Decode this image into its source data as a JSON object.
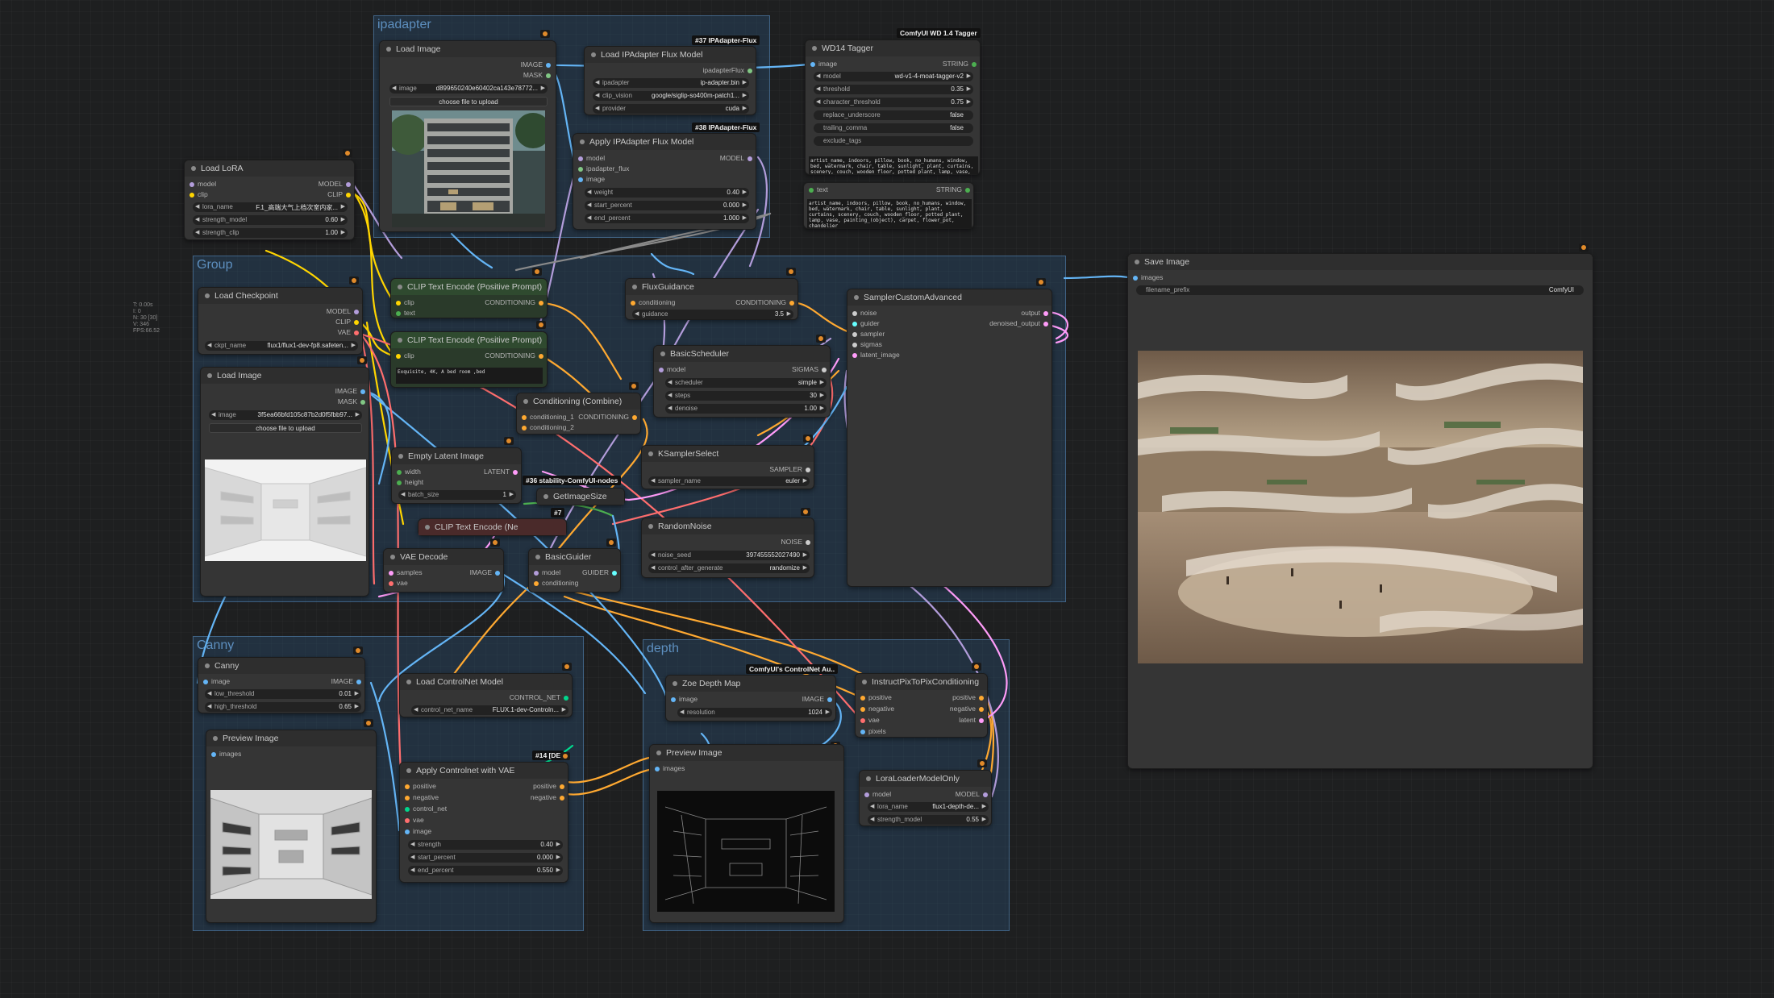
{
  "stats": {
    "l1": "T: 0.00s",
    "l2": "I: 0",
    "l3": "N: 30 [30]",
    "l4": "V: 346",
    "l5": "FPS:66.52"
  },
  "groups": {
    "ipadapter": "ipadapter",
    "group": "Group",
    "canny": "Canny",
    "depth": "depth"
  },
  "badges": {
    "b37": "#37 IPAdapter-Flux",
    "b38": "#38 IPAdapter-Flux",
    "wd14": "ComfyUI WD 1.4 Tagger",
    "b36": "#36 stability-ComfyUI-nodes",
    "b7": "#7",
    "ctrlnet": "ComfyUI's ControlNet Au..",
    "b14": "#14 [DE"
  },
  "load_image_top": {
    "title": "Load Image",
    "out_image": "IMAGE",
    "out_mask": "MASK",
    "w_image_label": "image",
    "w_image_value": "d899650240e60402ca143e78772...",
    "btn": "choose file to upload"
  },
  "ipa_model": {
    "title": "Load IPAdapter Flux Model",
    "out": "ipadapterFlux",
    "w1l": "ipadapter",
    "w1v": "ip-adapter.bin",
    "w2l": "clip_vision",
    "w2v": "google/siglip-so400m-patch1...",
    "w3l": "provider",
    "w3v": "cuda"
  },
  "apply_ipa": {
    "title": "Apply IPAdapter Flux Model",
    "in1": "model",
    "in2": "ipadapter_flux",
    "in3": "image",
    "out": "MODEL",
    "w1l": "weight",
    "w1v": "0.40",
    "w2l": "start_percent",
    "w2v": "0.000",
    "w3l": "end_percent",
    "w3v": "1.000"
  },
  "wd14": {
    "title": "WD14 Tagger",
    "in": "image",
    "out": "STRING",
    "w1l": "model",
    "w1v": "wd-v1-4-moat-tagger-v2",
    "w2l": "threshold",
    "w2v": "0.35",
    "w3l": "character_threshold",
    "w3v": "0.75",
    "w4l": "replace_underscore",
    "w4v": "false",
    "w5l": "trailing_comma",
    "w5v": "false",
    "w6l": "exclude_tags",
    "tags": "artist_name, indoors, pillow, book, no_humans, window, bed, watermark, chair, table, sunlight, plant, curtains, scenery, couch, wooden_floor, potted_plant, lamp, vase, painting_(object), carpet, flower_pot, chandelier"
  },
  "show_text": {
    "in": "text",
    "out": "STRING",
    "text": "artist_name, indoors, pillow, book, no_humans, window, bed, watermark, chair, table, sunlight, plant, curtains, scenery, couch, wooden_floor, potted_plant, lamp, vase, painting_(object), carpet, flower_pot, chandelier"
  },
  "load_lora": {
    "title": "Load LoRA",
    "in1": "model",
    "in2": "clip",
    "out1": "MODEL",
    "out2": "CLIP",
    "w1l": "lora_name",
    "w1v": "F.1_高端大气上档次室内家...",
    "w2l": "strength_model",
    "w2v": "0.60",
    "w3l": "strength_clip",
    "w3v": "1.00"
  },
  "load_ckpt": {
    "title": "Load Checkpoint",
    "o1": "MODEL",
    "o2": "CLIP",
    "o3": "VAE",
    "wl": "ckpt_name",
    "wv": "flux1/flux1-dev-fp8.safeten..."
  },
  "load_image_mid": {
    "title": "Load Image",
    "o1": "IMAGE",
    "o2": "MASK",
    "wl": "image",
    "wv": "3f5ea66bfd105c87b2d0f5fbb97...",
    "btn": "choose file to upload"
  },
  "clip_pos1": {
    "title": "CLIP Text Encode (Positive Prompt)",
    "in1": "clip",
    "in2": "text",
    "out": "CONDITIONING"
  },
  "clip_pos2": {
    "title": "CLIP Text Encode (Positive Prompt)",
    "in1": "clip",
    "out": "CONDITIONING",
    "text": "Exquisite, 4K, A bed room ,bed"
  },
  "flux_guid": {
    "title": "FluxGuidance",
    "in": "conditioning",
    "out": "CONDITIONING",
    "wl": "guidance",
    "wv": "3.5"
  },
  "sched": {
    "title": "BasicScheduler",
    "in": "model",
    "out": "SIGMAS",
    "w1l": "scheduler",
    "w1v": "simple",
    "w2l": "steps",
    "w2v": "30",
    "w3l": "denoise",
    "w3v": "1.00"
  },
  "cond_comb": {
    "title": "Conditioning (Combine)",
    "in1": "conditioning_1",
    "in2": "conditioning_2",
    "out": "CONDITIONING"
  },
  "empty_latent": {
    "title": "Empty Latent Image",
    "in1": "width",
    "in2": "height",
    "out": "LATENT",
    "wl": "batch_size",
    "wv": "1"
  },
  "get_size": {
    "title": "GetImageSize"
  },
  "clip_neg": {
    "title": "CLIP Text Encode (Ne"
  },
  "vae_decode": {
    "title": "VAE Decode",
    "in1": "samples",
    "in2": "vae",
    "out": "IMAGE"
  },
  "basic_guider": {
    "title": "BasicGuider",
    "in1": "model",
    "in2": "conditioning",
    "out": "GUIDER"
  },
  "ksampler_sel": {
    "title": "KSamplerSelect",
    "out": "SAMPLER",
    "wl": "sampler_name",
    "wv": "euler"
  },
  "random_noise": {
    "title": "RandomNoise",
    "out": "NOISE",
    "w1l": "noise_seed",
    "w1v": "397455552027490",
    "w2l": "control_after_generate",
    "w2v": "randomize"
  },
  "sampler_adv": {
    "title": "SamplerCustomAdvanced",
    "in1": "noise",
    "in2": "guider",
    "in3": "sampler",
    "in4": "sigmas",
    "in5": "latent_image",
    "out1": "output",
    "out2": "denoised_output"
  },
  "save_image": {
    "title": "Save Image",
    "in": "images",
    "wl": "filename_prefix",
    "wv": "ComfyUI"
  },
  "canny": {
    "title": "Canny",
    "in": "image",
    "out": "IMAGE",
    "w1l": "low_threshold",
    "w1v": "0.01",
    "w2l": "high_threshold",
    "w2v": "0.65"
  },
  "preview1": {
    "title": "Preview Image",
    "in": "images"
  },
  "load_cn": {
    "title": "Load ControlNet Model",
    "out": "CONTROL_NET",
    "wl": "control_net_name",
    "wv": "FLUX.1-dev-Controln..."
  },
  "apply_cn": {
    "title": "Apply Controlnet with VAE",
    "in1": "positive",
    "in2": "negative",
    "in3": "control_net",
    "in4": "vae",
    "in5": "image",
    "out1": "positive",
    "out2": "negative",
    "w1l": "strength",
    "w1v": "0.40",
    "w2l": "start_percent",
    "w2v": "0.000",
    "w3l": "end_percent",
    "w3v": "0.550"
  },
  "zoe": {
    "title": "Zoe Depth Map",
    "in": "image",
    "out": "IMAGE",
    "wl": "resolution",
    "wv": "1024"
  },
  "ip2p": {
    "title": "InstructPixToPixConditioning",
    "in1": "positive",
    "in2": "negative",
    "in3": "vae",
    "in4": "pixels",
    "out1": "positive",
    "out2": "negative",
    "out3": "latent"
  },
  "preview2": {
    "title": "Preview Image",
    "in": "images"
  },
  "lora_model": {
    "title": "LoraLoaderModelOnly",
    "in": "model",
    "out": "MODEL",
    "w1l": "lora_name",
    "w1v": "flux1-depth-de...",
    "w2l": "strength_model",
    "w2v": "0.55"
  },
  "colors": {
    "model": "#b39ddb",
    "clip": "#ffd500",
    "vae": "#ff6e6e",
    "image": "#64b5f6",
    "conditioning": "#ffa931",
    "latent": "#ff9cf9",
    "mask": "#81c784",
    "control": "#00d78d",
    "green": "#4caf50"
  }
}
